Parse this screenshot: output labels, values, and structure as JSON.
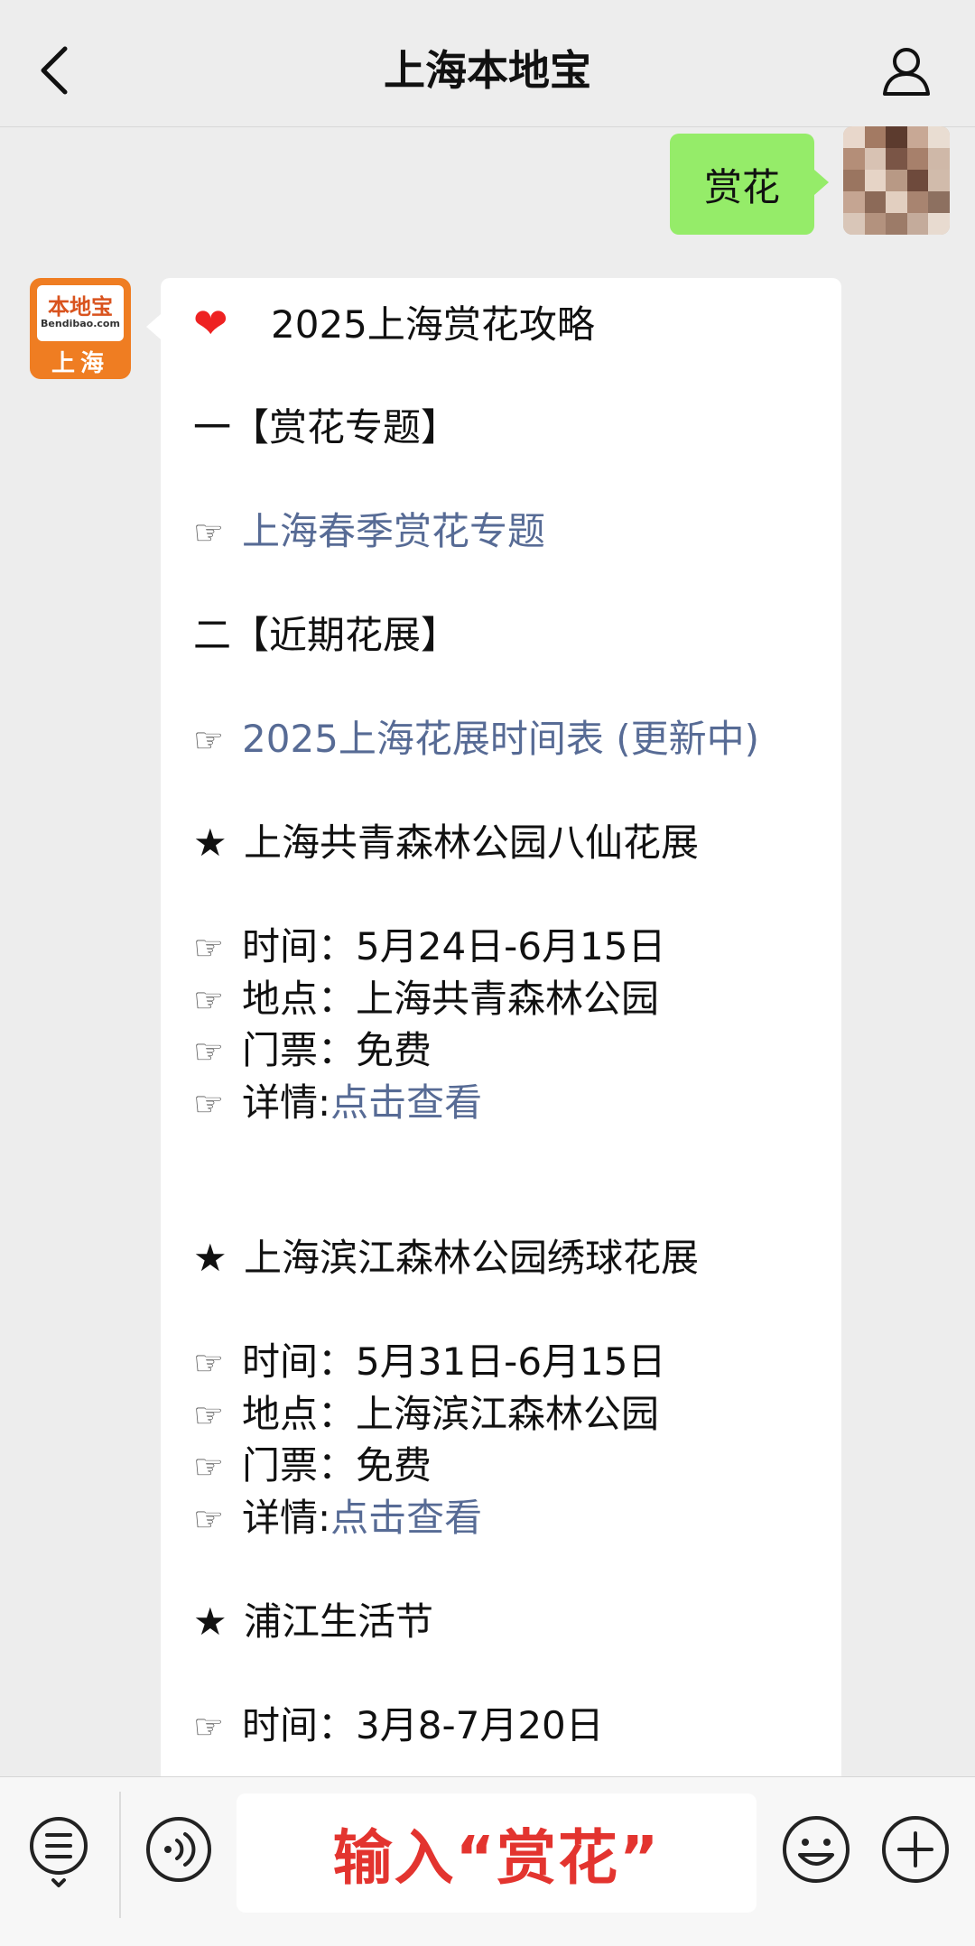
{
  "header": {
    "title": "上海本地宝"
  },
  "user_message": {
    "text": "赏花"
  },
  "bot_avatar": {
    "brand": "本地宝",
    "site": "Bendibao.com",
    "city": "上海"
  },
  "bot_message": {
    "heading": "2025上海赏花攻略",
    "section1": "一【赏花专题】",
    "link1": "上海春季赏花专题",
    "section2": "二【近期花展】",
    "link2": "2025上海花展时间表 (更新中)",
    "events": [
      {
        "title": "上海共青森林公园八仙花展",
        "time": "时间：5月24日-6月15日",
        "place": "地点：上海共青森林公园",
        "ticket": "门票：免费",
        "detail_label": "详情:",
        "detail_link": "点击查看"
      },
      {
        "title": "上海滨江森林公园绣球花展",
        "time": "时间：5月31日-6月15日",
        "place": "地点：上海滨江森林公园",
        "ticket": "门票：免费",
        "detail_label": "详情:",
        "detail_link": "点击查看"
      },
      {
        "title": "浦江生活节",
        "time": "时间：3月8-7月20日"
      }
    ]
  },
  "input": {
    "hint_text": "输入“赏花”"
  },
  "colors": {
    "link": "#576b95",
    "user_bubble": "#95ec69",
    "hint": "#e3342f",
    "heart": "#e22222"
  }
}
